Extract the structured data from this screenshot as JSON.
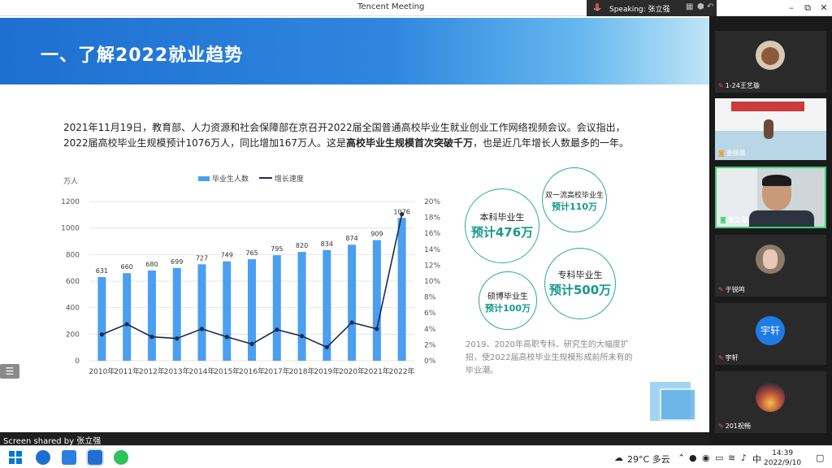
{
  "window": {
    "title": "Tencent Meeting",
    "speaking_label": "Speaking: 张立强",
    "minimize": "–",
    "maximize": "⧉",
    "close": "✕"
  },
  "slide": {
    "title": "一、了解2022就业趋势",
    "paragraph_before": "2021年11月19日，教育部、人力资源和社会保障部在京召开2022届全国普通高校毕业生就业创业工作网络视频会议。会议指出，2022届高校毕业生规模预计1076万人，同比增加167万人。这是",
    "paragraph_bold": "高校毕业生规模首次突破千万",
    "paragraph_after": "，也是近几年增长人数最多的一年。",
    "bubbles": [
      {
        "line1": "本科毕业生",
        "line2": "预计476万"
      },
      {
        "line1": "双一流高校毕业生",
        "line2": "预计110万"
      },
      {
        "line1": "硕博毕业生",
        "line2": "预计100万"
      },
      {
        "line1": "专科毕业生",
        "line2": "预计500万"
      }
    ],
    "note": "2019、2020年高职专科、研究生的大幅度扩招，使2022届高校毕业生规模形成前所未有的毕业潮。"
  },
  "chart_data": {
    "type": "bar",
    "y_unit_label": "万人",
    "categories": [
      "2010年",
      "2011年",
      "2012年",
      "2013年",
      "2014年",
      "2015年",
      "2016年",
      "2017年",
      "2018年",
      "2019年",
      "2020年",
      "2021年",
      "2022年"
    ],
    "series": [
      {
        "name": "毕业生人数",
        "kind": "bar",
        "axis": "left",
        "values": [
          631,
          660,
          680,
          699,
          727,
          749,
          765,
          795,
          820,
          834,
          874,
          909,
          1076
        ],
        "color": "#4a9ff0"
      },
      {
        "name": "增长速度",
        "kind": "line",
        "axis": "right",
        "values": [
          3.3,
          4.6,
          3.0,
          2.8,
          4.0,
          3.0,
          2.1,
          3.9,
          3.1,
          1.7,
          4.8,
          4.0,
          18.4
        ],
        "color": "#1e2a4a"
      }
    ],
    "ylim_left": [
      0,
      1200
    ],
    "yticks_left": [
      "0",
      "200",
      "400",
      "600",
      "800",
      "1000",
      "1200"
    ],
    "ylim_right": [
      0,
      20
    ],
    "yticks_right": [
      "0%",
      "2%",
      "4%",
      "6%",
      "8%",
      "10%",
      "12%",
      "14%",
      "16%",
      "18%",
      "20%"
    ],
    "grid": true,
    "legend_position": "top"
  },
  "share_bar": {
    "text": "Screen shared by 张立强"
  },
  "participants": [
    {
      "name": "1-24王艺璇"
    },
    {
      "name": "姜丽晨"
    },
    {
      "name": "张立强"
    },
    {
      "name": "于锐鸣"
    },
    {
      "name": "宇轩",
      "avatar_text": "宇轩"
    },
    {
      "name": "201祝畅"
    }
  ],
  "taskbar": {
    "weather": "29°C 多云",
    "ime": "中",
    "time": "14:39",
    "date": "2022/9/10"
  }
}
